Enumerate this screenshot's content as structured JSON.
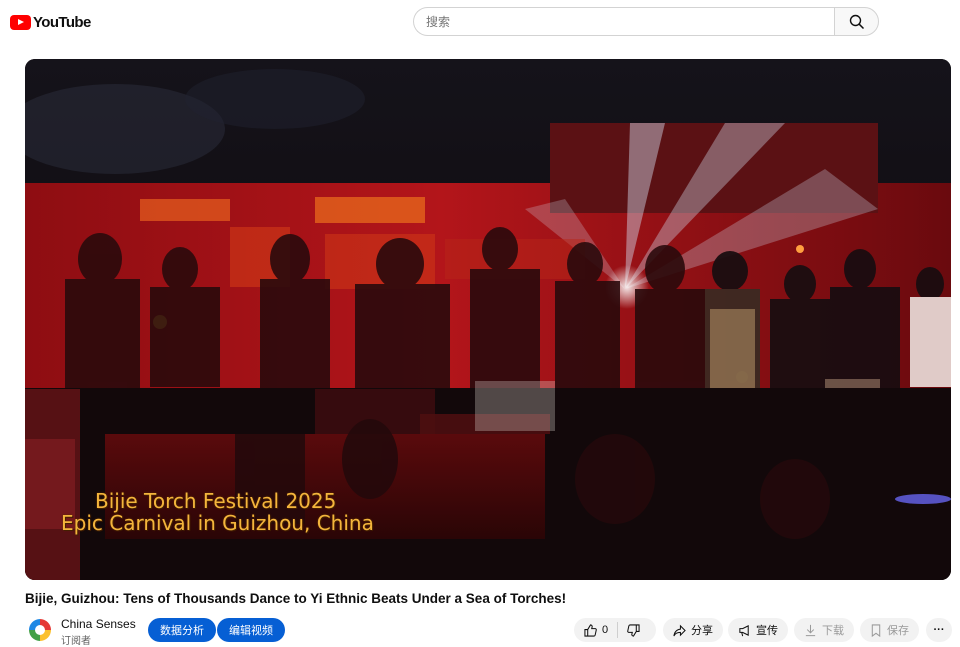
{
  "header": {
    "logo_text": "YouTube",
    "search_placeholder": "搜索"
  },
  "video": {
    "overlay_line1": "Bijie Torch Festival 2025",
    "overlay_line2": "Epic Carnival in Guizhou, China",
    "title": "Bijie, Guizhou: Tens of Thousands Dance to Yi Ethnic Beats Under a Sea of Torches!"
  },
  "channel": {
    "name": "China Senses",
    "subscribers": "订阅者"
  },
  "actions": {
    "analytics_label": "数据分析",
    "edit_label": "编辑视频",
    "like_count": "0",
    "share_label": "分享",
    "promote_label": "宣传",
    "download_label": "下载",
    "save_label": "保存",
    "more_label": "···"
  },
  "colors": {
    "brand_red": "#ff0000",
    "action_blue": "#065fd4",
    "overlay_gold": "#f4b53c"
  }
}
